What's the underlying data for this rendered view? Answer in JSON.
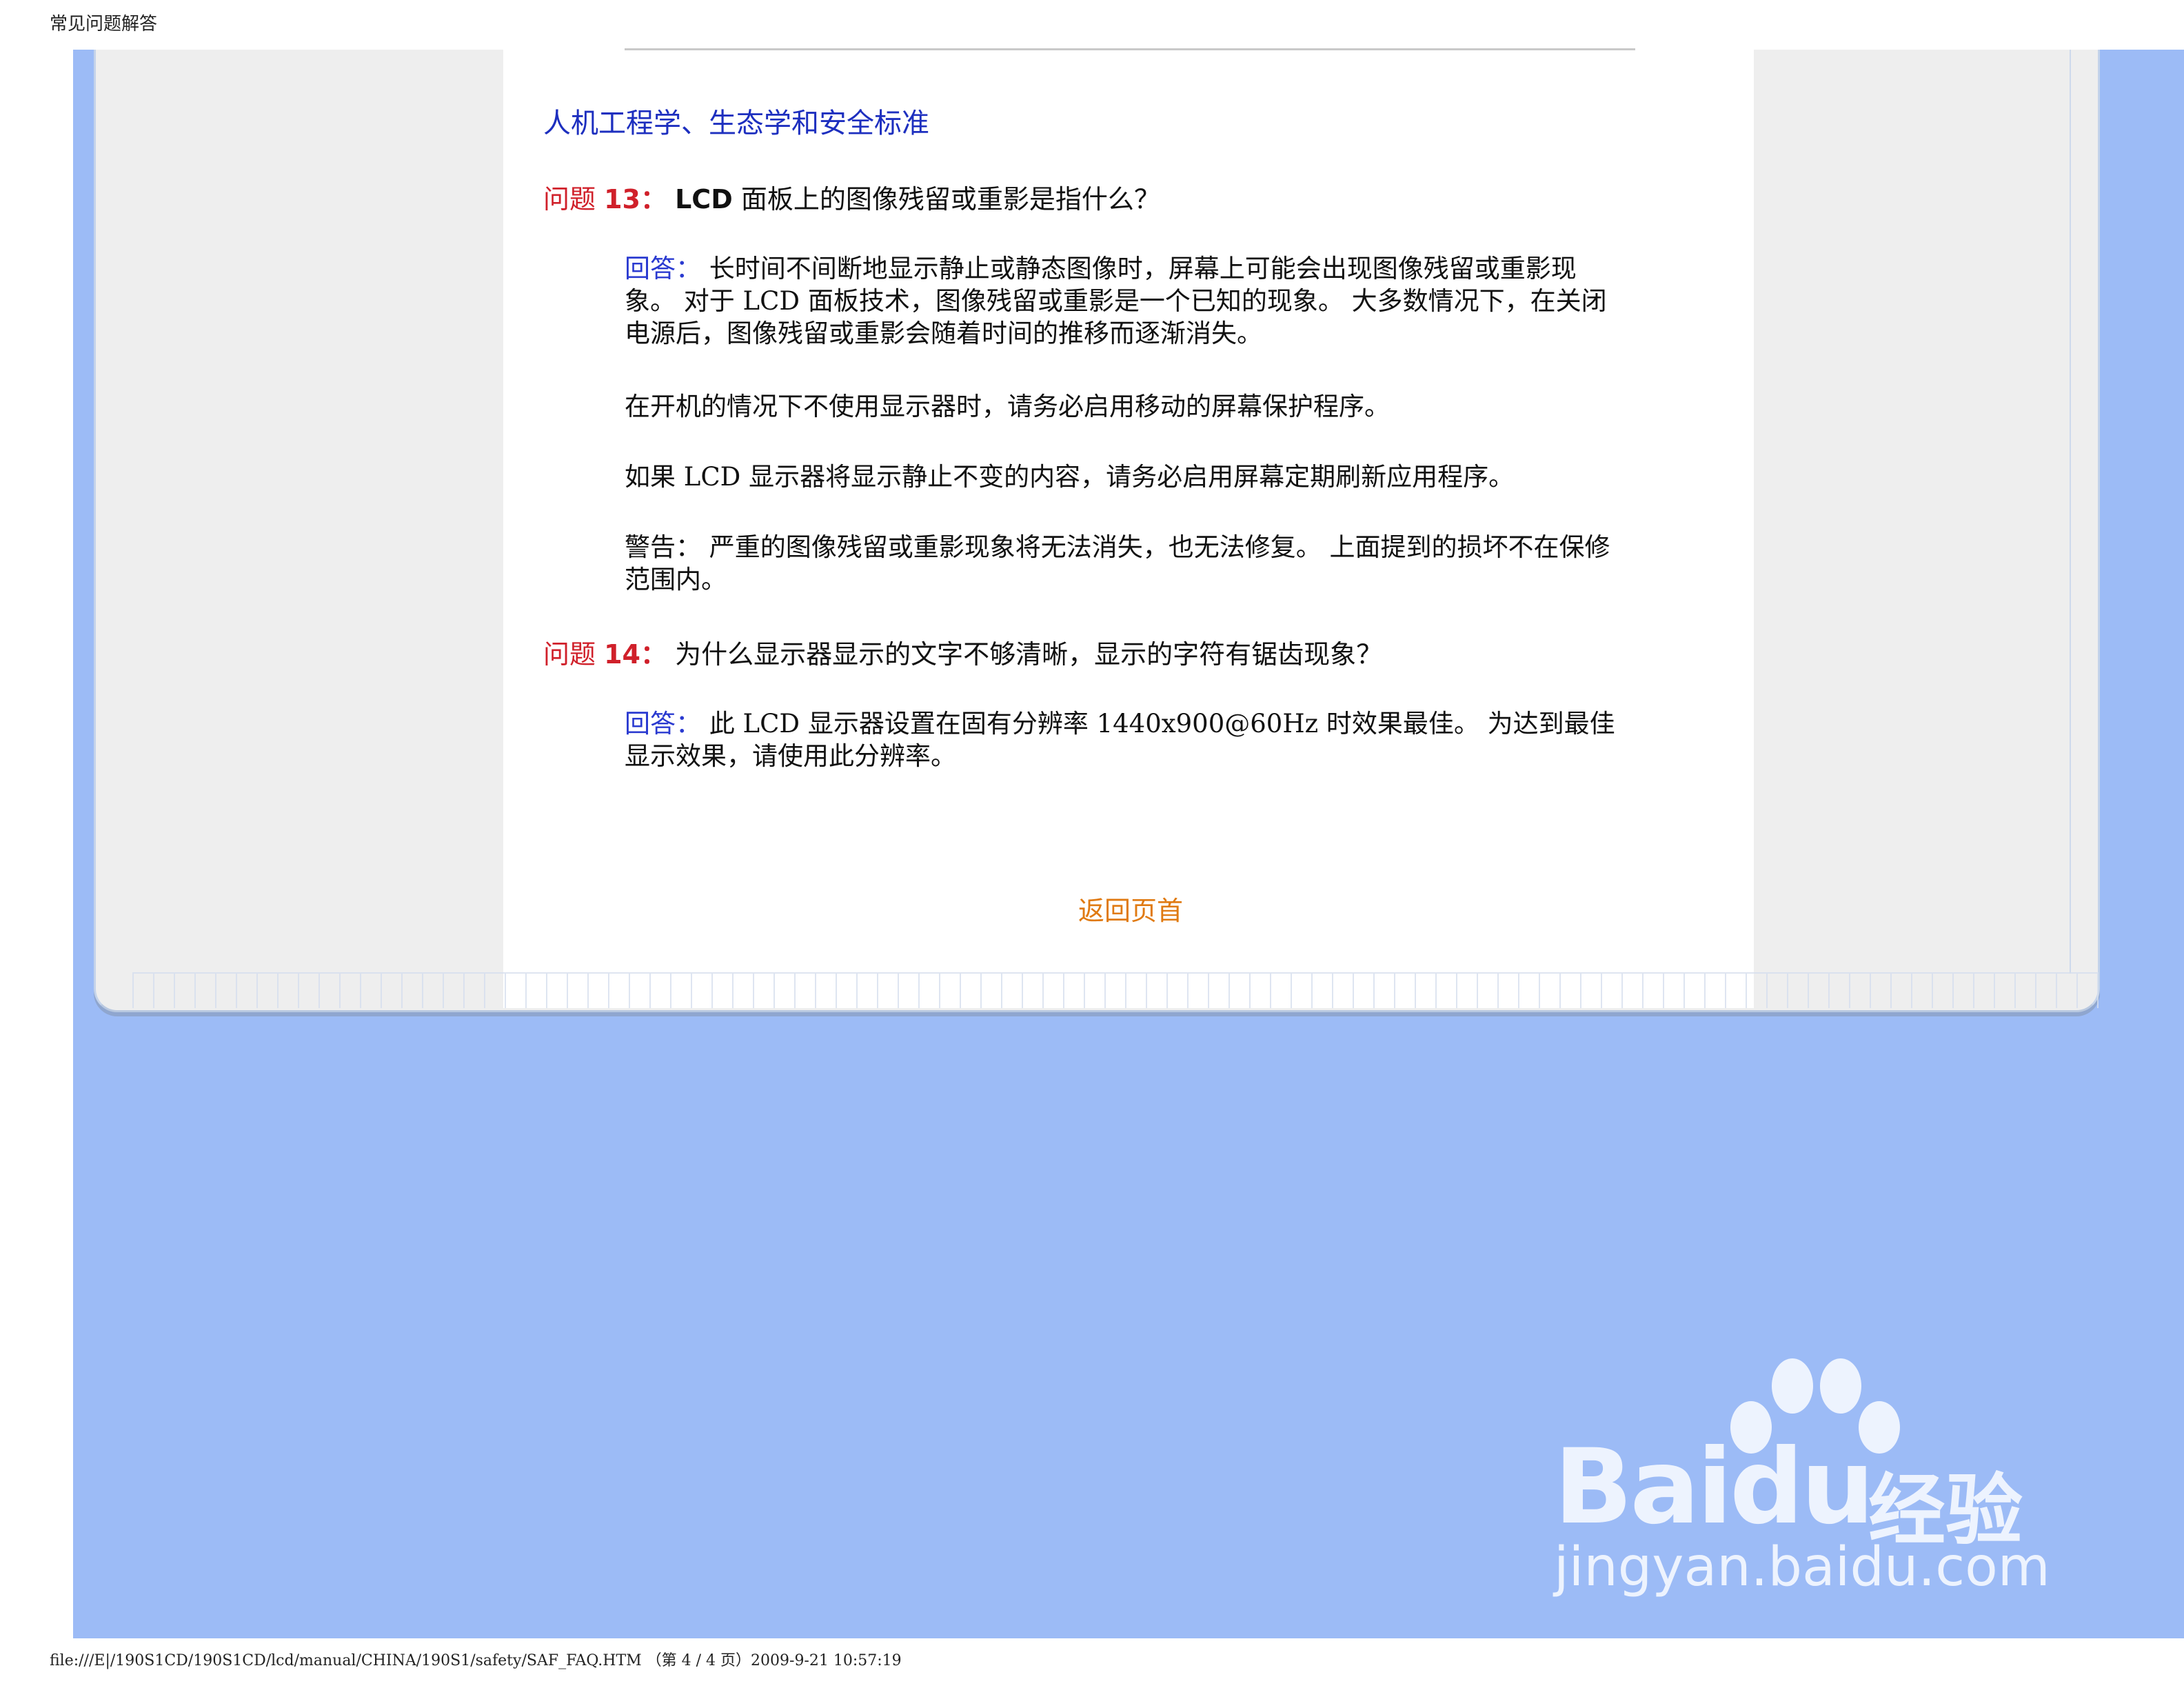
{
  "header": {
    "doc_title": "常见问题解答"
  },
  "section": {
    "title": "人机工程学、生态学和安全标准"
  },
  "q13": {
    "label": "问题",
    "number": "13：",
    "lcd": "LCD",
    "text": " 面板上的图像残留或重影是指什么？",
    "answer_label": "回答：",
    "answer_text": "长时间不间断地显示静止或静态图像时，屏幕上可能会出现图像残留或重影现象。 对于 LCD 面板技术，图像残留或重影是一个已知的现象。 大多数情况下，在关闭电源后，图像残留或重影会随着时间的推移而逐渐消失。",
    "para2": "在开机的情况下不使用显示器时，请务必启用移动的屏幕保护程序。",
    "para3": "如果 LCD 显示器将显示静止不变的内容，请务必启用屏幕定期刷新应用程序。",
    "warning": "警告： 严重的图像残留或重影现象将无法消失，也无法修复。 上面提到的损坏不在保修范围内。"
  },
  "q14": {
    "label": "问题",
    "number": "14：",
    "text": "为什么显示器显示的文字不够清晰，显示的字符有锯齿现象？",
    "answer_label": "回答：",
    "answer_text": "此 LCD 显示器设置在固有分辨率 1440x900@60Hz 时效果最佳。 为达到最佳显示效果，请使用此分辨率。"
  },
  "nav": {
    "back_to_top": "返回页首"
  },
  "watermark": {
    "brand": "Baidu",
    "cn": "经验",
    "url": "jingyan.baidu.com"
  },
  "footer": {
    "path": "file:///E|/190S1CD/190S1CD/lcd/manual/CHINA/190S1/safety/SAF_FAQ.HTM （第 4 / 4 页）2009-9-21 10:57:19"
  },
  "colors": {
    "page_bg": "#9cbbf6",
    "panel": "#eeeeee",
    "title_blue": "#1d2fbf",
    "question_red": "#d0202a",
    "answer_blue": "#2a3ad0",
    "link_orange": "#e07a12"
  }
}
